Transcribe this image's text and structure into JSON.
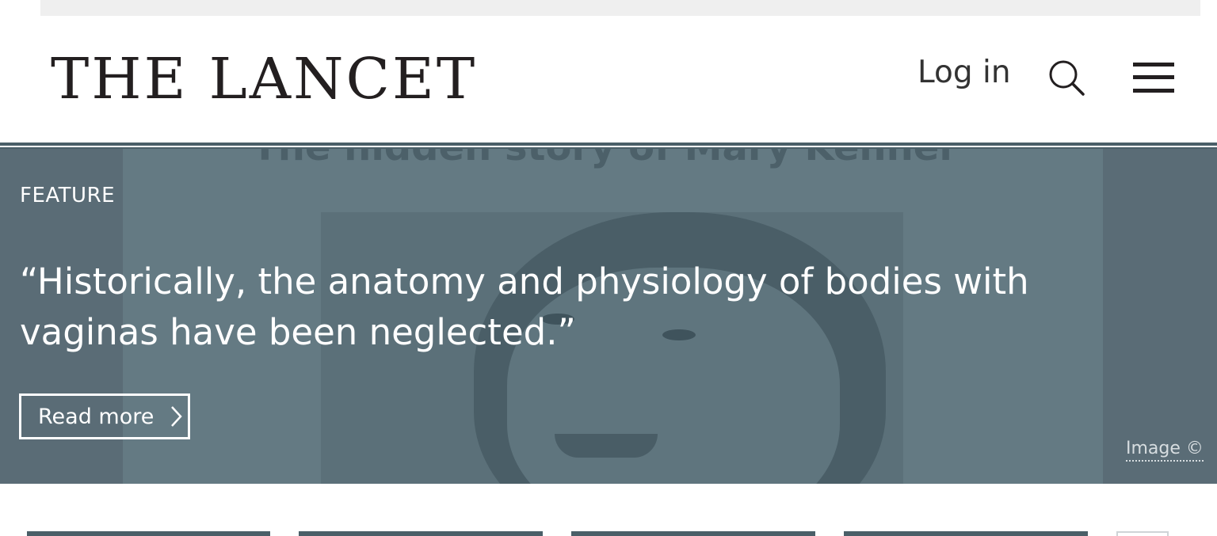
{
  "site": {
    "logo_text": "THE LANCET",
    "login_label": "Log in"
  },
  "hero": {
    "category": "FEATURE",
    "background_caption": "The hidden story of Mary Kenner",
    "quote": "“Historically, the anatomy and physiology of bodies with vaginas have been neglected.”",
    "read_more_label": "Read more",
    "image_credit": "Image ©"
  },
  "icons": {
    "search": "search-icon",
    "menu": "hamburger-menu-icon",
    "read_more": "chevron-right-icon"
  },
  "colors": {
    "brand_dark": "#231f20",
    "accent_slate": "#4a5f68",
    "hero_overlay": "#5a6c76",
    "text_on_hero": "#ffffff"
  }
}
